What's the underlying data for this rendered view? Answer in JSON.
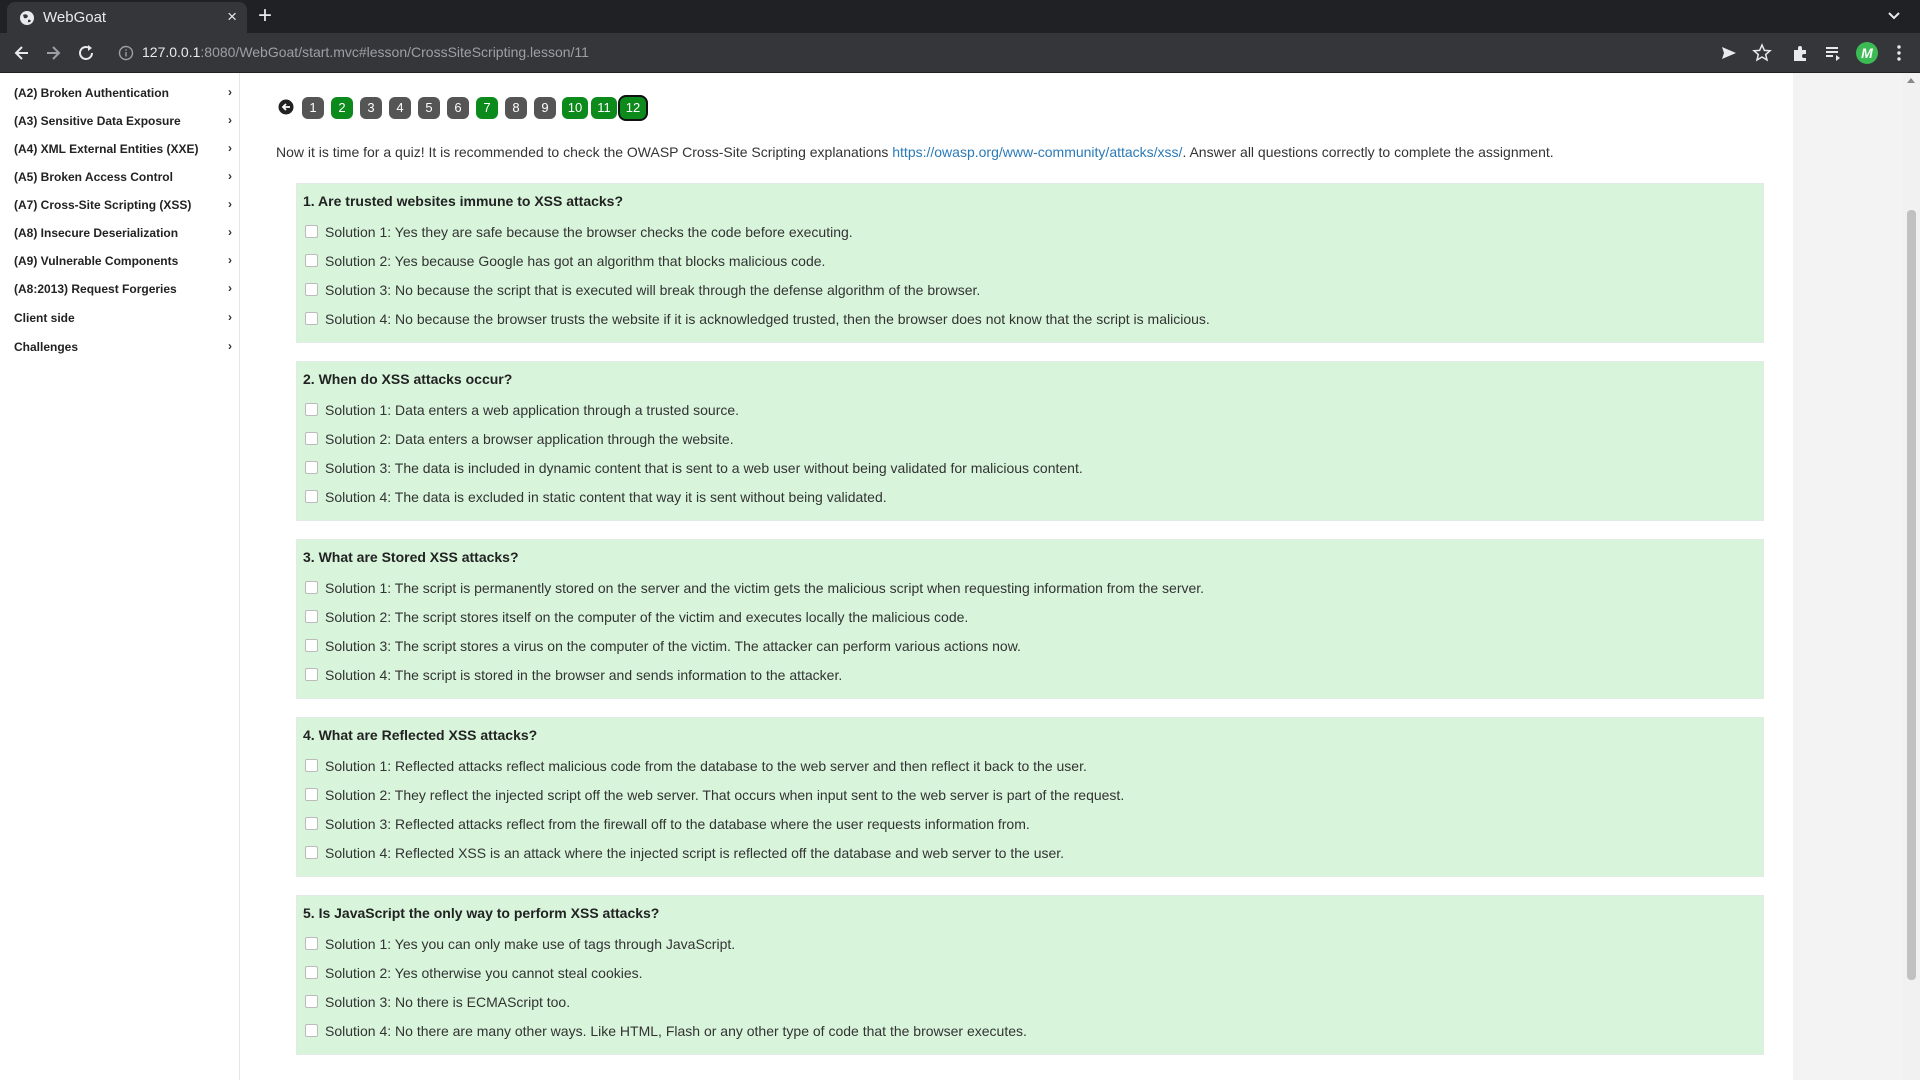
{
  "browser": {
    "tab_title": "WebGoat",
    "tab_close": "×",
    "new_tab": "+",
    "url_host": "127.0.0.1",
    "url_rest": ":8080/WebGoat/start.mvc#lesson/CrossSiteScripting.lesson/11",
    "profile_letter": "M"
  },
  "sidebar": {
    "items": [
      {
        "label": "(A2) Broken Authentication"
      },
      {
        "label": "(A3) Sensitive Data Exposure"
      },
      {
        "label": "(A4) XML External Entities (XXE)"
      },
      {
        "label": "(A5) Broken Access Control"
      },
      {
        "label": "(A7) Cross-Site Scripting (XSS)"
      },
      {
        "label": "(A8) Insecure Deserialization"
      },
      {
        "label": "(A9) Vulnerable Components"
      },
      {
        "label": "(A8:2013) Request Forgeries"
      },
      {
        "label": "Client side"
      },
      {
        "label": "Challenges"
      }
    ]
  },
  "pager": {
    "pages": [
      {
        "label": "1",
        "state": "gray"
      },
      {
        "label": "2",
        "state": "green"
      },
      {
        "label": "3",
        "state": "gray"
      },
      {
        "label": "4",
        "state": "gray"
      },
      {
        "label": "5",
        "state": "gray"
      },
      {
        "label": "6",
        "state": "gray"
      },
      {
        "label": "7",
        "state": "green"
      },
      {
        "label": "8",
        "state": "gray"
      },
      {
        "label": "9",
        "state": "gray"
      },
      {
        "label": "10",
        "state": "green"
      },
      {
        "label": "11",
        "state": "green"
      },
      {
        "label": "12",
        "state": "current"
      }
    ]
  },
  "intro": {
    "before": "Now it is time for a quiz! It is recommended to check the OWASP Cross-Site Scripting explanations ",
    "link": "https://owasp.org/www-community/attacks/xss/",
    "after": ". Answer all questions correctly to complete the assignment."
  },
  "questions": [
    {
      "title": "1. Are trusted websites immune to XSS attacks?",
      "options": [
        "Solution 1: Yes they are safe because the browser checks the code before executing.",
        "Solution 2: Yes because Google has got an algorithm that blocks malicious code.",
        "Solution 3: No because the script that is executed will break through the defense algorithm of the browser.",
        "Solution 4: No because the browser trusts the website if it is acknowledged trusted, then the browser does not know that the script is malicious."
      ]
    },
    {
      "title": "2. When do XSS attacks occur?",
      "options": [
        "Solution 1: Data enters a web application through a trusted source.",
        "Solution 2: Data enters a browser application through the website.",
        "Solution 3: The data is included in dynamic content that is sent to a web user without being validated for malicious content.",
        "Solution 4: The data is excluded in static content that way it is sent without being validated."
      ]
    },
    {
      "title": "3. What are Stored XSS attacks?",
      "options": [
        "Solution 1: The script is permanently stored on the server and the victim gets the malicious script when requesting information from the server.",
        "Solution 2: The script stores itself on the computer of the victim and executes locally the malicious code.",
        "Solution 3: The script stores a virus on the computer of the victim. The attacker can perform various actions now.",
        "Solution 4: The script is stored in the browser and sends information to the attacker."
      ]
    },
    {
      "title": "4. What are Reflected XSS attacks?",
      "options": [
        "Solution 1: Reflected attacks reflect malicious code from the database to the web server and then reflect it back to the user.",
        "Solution 2: They reflect the injected script off the web server. That occurs when input sent to the web server is part of the request.",
        "Solution 3: Reflected attacks reflect from the firewall off to the database where the user requests information from.",
        "Solution 4: Reflected XSS is an attack where the injected script is reflected off the database and web server to the user."
      ]
    },
    {
      "title": "5. Is JavaScript the only way to perform XSS attacks?",
      "options": [
        "Solution 1: Yes you can only make use of tags through JavaScript.",
        "Solution 2: Yes otherwise you cannot steal cookies.",
        "Solution 3: No there is ECMAScript too.",
        "Solution 4: No there are many other ways. Like HTML, Flash or any other type of code that the browser executes."
      ]
    }
  ]
}
